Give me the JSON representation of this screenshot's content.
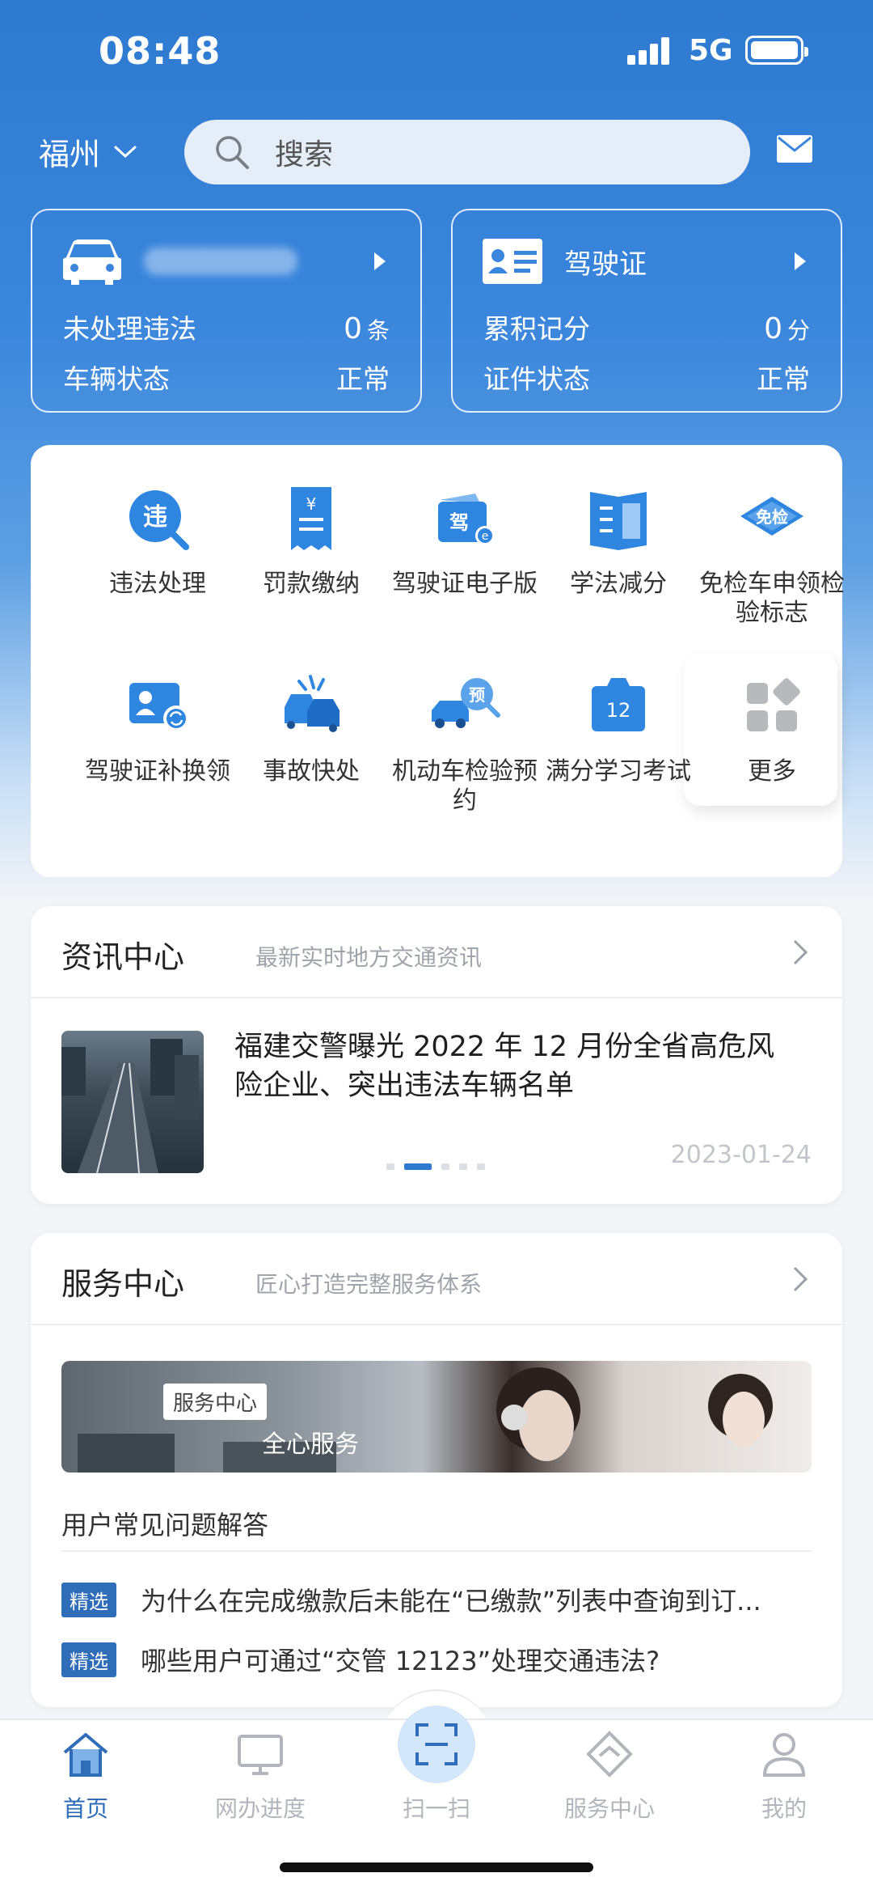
{
  "status_bar": {
    "time": "08:48",
    "network": "5G"
  },
  "header": {
    "city": "福州",
    "search_placeholder": "搜索"
  },
  "vehicle_card": {
    "violations_label": "未处理违法",
    "violations_value": "0",
    "violations_unit": "条",
    "status_label": "车辆状态",
    "status_value": "正常"
  },
  "license_card": {
    "title": "驾驶证",
    "points_label": "累积记分",
    "points_value": "0",
    "points_unit": "分",
    "status_label": "证件状态",
    "status_value": "正常"
  },
  "services": [
    {
      "label": "违法处理",
      "icon": "violation-icon"
    },
    {
      "label": "罚款缴纳",
      "icon": "fine-icon"
    },
    {
      "label": "驾驶证电子版",
      "icon": "e-license-icon"
    },
    {
      "label": "学法减分",
      "icon": "book-icon"
    },
    {
      "label": "免检车申领检验标志",
      "icon": "exempt-badge-icon"
    },
    {
      "label": "驾驶证补换领",
      "icon": "license-replace-icon"
    },
    {
      "label": "事故快处",
      "icon": "accident-icon"
    },
    {
      "label": "机动车检验预约",
      "icon": "inspection-icon"
    },
    {
      "label": "满分学习考试",
      "icon": "calendar-12-icon"
    },
    {
      "label": "更多",
      "icon": "more-grid-icon"
    }
  ],
  "news": {
    "title": "资讯中心",
    "subtitle": "最新实时地方交通资讯",
    "headline": "福建交警曝光 2022 年 12 月份全省高危风险企业、突出违法车辆名单",
    "date": "2023-01-24"
  },
  "service_center": {
    "title": "服务中心",
    "subtitle": "匠心打造完整服务体系",
    "banner_tag": "服务中心",
    "banner_text": "全心服务",
    "faq_title": "用户常见问题解答",
    "faq": [
      {
        "badge": "精选",
        "question": "为什么在完成缴款后未能在“已缴款”列表中查询到订..."
      },
      {
        "badge": "精选",
        "question": "哪些用户可通过“交管 12123”处理交通违法?"
      }
    ]
  },
  "tabs": [
    {
      "label": "首页",
      "icon": "home-icon",
      "active": true
    },
    {
      "label": "网办进度",
      "icon": "monitor-icon",
      "active": false
    },
    {
      "label": "扫一扫",
      "icon": "scan-icon",
      "active": false
    },
    {
      "label": "服务中心",
      "icon": "service-diamond-icon",
      "active": false
    },
    {
      "label": "我的",
      "icon": "profile-icon",
      "active": false
    }
  ],
  "colors": {
    "primary": "#2f7ad1",
    "accent_blue": "#2f6db8",
    "tab_inactive": "#b2b6bc"
  }
}
